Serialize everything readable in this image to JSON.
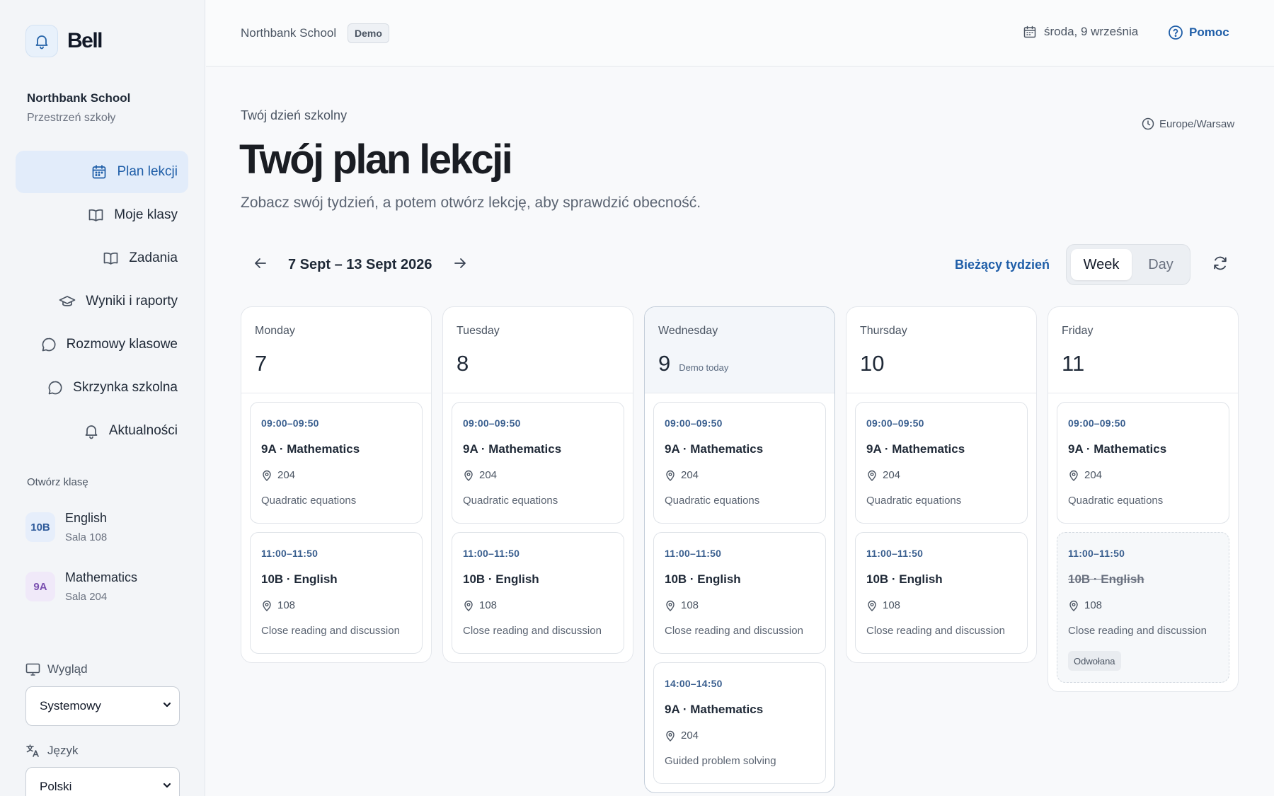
{
  "app": {
    "name": "Bell"
  },
  "sidebar": {
    "school_name": "Northbank School",
    "school_sub": "Przestrzeń szkoły",
    "nav": [
      {
        "label": "Plan lekcji",
        "icon": "calendar-icon",
        "active": true
      },
      {
        "label": "Moje klasy",
        "icon": "book-icon"
      },
      {
        "label": "Zadania",
        "icon": "book-icon"
      },
      {
        "label": "Wyniki i raporty",
        "icon": "graduation-cap-icon"
      },
      {
        "label": "Rozmowy klasowe",
        "icon": "chat-bubble-icon"
      },
      {
        "label": "Skrzynka szkolna",
        "icon": "chat-bubble-icon"
      },
      {
        "label": "Aktualności",
        "icon": "bell-icon"
      }
    ],
    "open_class_title": "Otwórz klasę",
    "classes": [
      {
        "code": "10B",
        "name": "English",
        "room": "Sala 108",
        "color": "#2e5a9a"
      },
      {
        "code": "9A",
        "name": "Mathematics",
        "room": "Sala 204",
        "color": "#7a4fb0"
      }
    ],
    "appearance_label": "Wygląd",
    "appearance_value": "Systemowy",
    "language_label": "Język",
    "language_value": "Polski"
  },
  "topbar": {
    "school": "Northbank School",
    "badge": "Demo",
    "date": "środa, 9 września",
    "help": "Pomoc"
  },
  "header": {
    "eyebrow": "Twój dzień szkolny",
    "title": "Twój plan lekcji",
    "subtitle": "Zobacz swój tydzień, a potem otwórz lekcję, aby sprawdzić obecność.",
    "timezone": "Europe/Warsaw"
  },
  "controls": {
    "range": "7 Sept – 13 Sept 2026",
    "current_week": "Bieżący tydzień",
    "view_week": "Week",
    "view_day": "Day",
    "selected_view": "Week"
  },
  "days": [
    {
      "name": "Monday",
      "num": "7",
      "lessons": [
        {
          "time": "09:00–09:50",
          "title": "9A · Mathematics",
          "room": "204",
          "topic": "Quadratic equations"
        },
        {
          "time": "11:00–11:50",
          "title": "10B · English",
          "room": "108",
          "topic": "Close reading and discussion"
        }
      ]
    },
    {
      "name": "Tuesday",
      "num": "8",
      "lessons": [
        {
          "time": "09:00–09:50",
          "title": "9A · Mathematics",
          "room": "204",
          "topic": "Quadratic equations"
        },
        {
          "time": "11:00–11:50",
          "title": "10B · English",
          "room": "108",
          "topic": "Close reading and discussion"
        }
      ]
    },
    {
      "name": "Wednesday",
      "num": "9",
      "today_tag": "Demo today",
      "lessons": [
        {
          "time": "09:00–09:50",
          "title": "9A · Mathematics",
          "room": "204",
          "topic": "Quadratic equations"
        },
        {
          "time": "11:00–11:50",
          "title": "10B · English",
          "room": "108",
          "topic": "Close reading and discussion"
        },
        {
          "time": "14:00–14:50",
          "title": "9A · Mathematics",
          "room": "204",
          "topic": "Guided problem solving"
        }
      ]
    },
    {
      "name": "Thursday",
      "num": "10",
      "lessons": [
        {
          "time": "09:00–09:50",
          "title": "9A · Mathematics",
          "room": "204",
          "topic": "Quadratic equations"
        },
        {
          "time": "11:00–11:50",
          "title": "10B · English",
          "room": "108",
          "topic": "Close reading and discussion"
        }
      ]
    },
    {
      "name": "Friday",
      "num": "11",
      "lessons": [
        {
          "time": "09:00–09:50",
          "title": "9A · Mathematics",
          "room": "204",
          "topic": "Quadratic equations"
        },
        {
          "time": "11:00–11:50",
          "title": "10B · English",
          "room": "108",
          "topic": "Close reading and discussion",
          "status": "Odwołana"
        }
      ]
    }
  ]
}
